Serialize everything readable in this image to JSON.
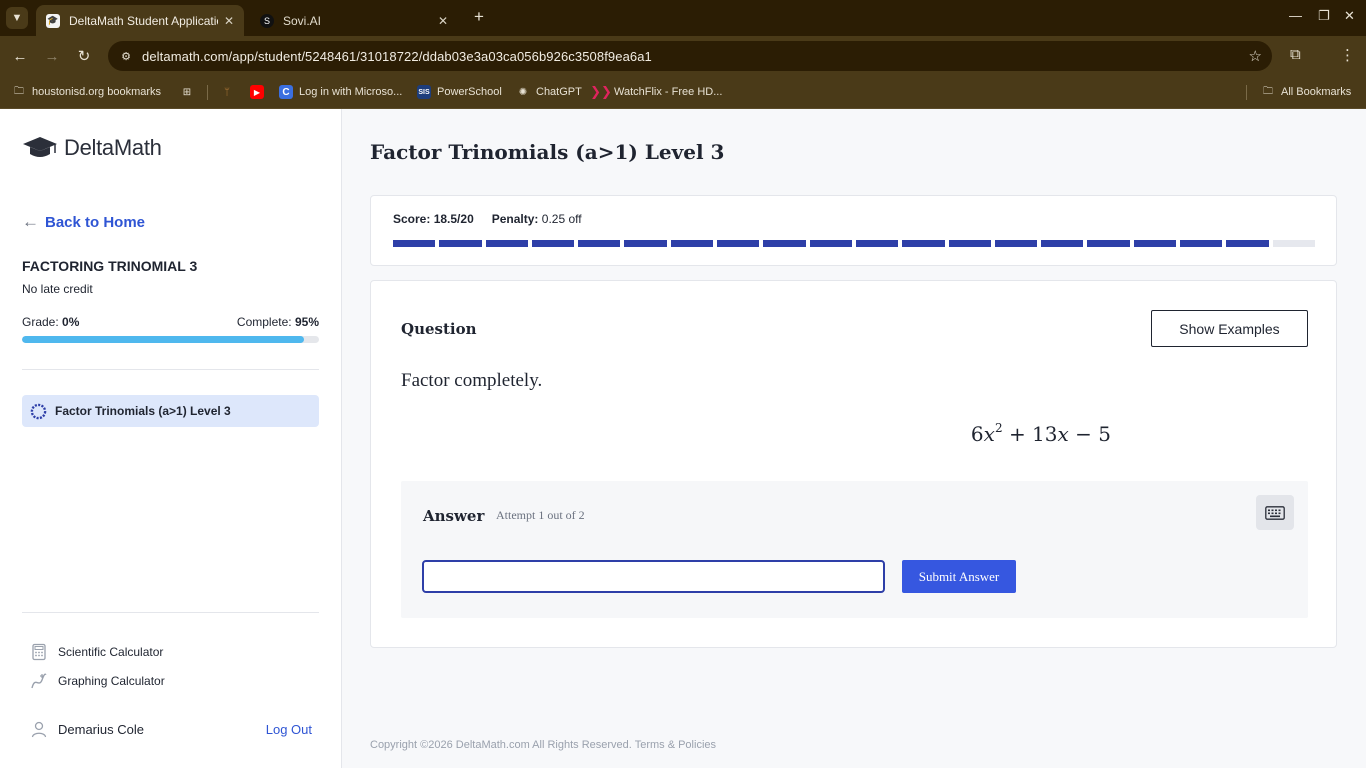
{
  "browser": {
    "tabs": [
      {
        "title": "DeltaMath Student Application",
        "active": true,
        "favicon": "deltamath-cap-icon"
      },
      {
        "title": "Sovi.AI",
        "active": false,
        "favicon": "sovi-icon"
      }
    ],
    "url": "deltamath.com/app/student/5248461/31018722/ddab03e3a03ca056b926c3508f9ea6a1",
    "bookmarks": [
      {
        "label": "houstonisd.org bookmarks",
        "icon": "folder-icon"
      },
      {
        "label": "",
        "icon": "apps-grid-icon"
      },
      {
        "label": "",
        "icon": "figure-icon"
      },
      {
        "label": "",
        "icon": "youtube-icon"
      },
      {
        "label": "Log in with Microso...",
        "icon": "c-icon"
      },
      {
        "label": "PowerSchool",
        "icon": "sis-icon"
      },
      {
        "label": "ChatGPT",
        "icon": "chatgpt-icon"
      },
      {
        "label": "WatchFlix - Free HD...",
        "icon": "watchflix-icon"
      }
    ],
    "all_bookmarks": "All Bookmarks",
    "colors": {
      "frame": "#2b1d04",
      "toolbar": "#4a3a18"
    }
  },
  "sidebar": {
    "logo": {
      "prefix": "Delta",
      "suffix": "Math"
    },
    "back_link": "Back to Home",
    "assignment_title": "FACTORING TRINOMIAL 3",
    "late_credit": "No late credit",
    "grade_label": "Grade:",
    "grade_value": "0%",
    "complete_label": "Complete:",
    "complete_value": "95%",
    "complete_fraction": 0.95,
    "skill": "Factor Trinomials (a>1) Level 3",
    "tools": [
      {
        "label": "Scientific Calculator",
        "icon": "calculator-icon"
      },
      {
        "label": "Graphing Calculator",
        "icon": "graph-icon"
      }
    ],
    "user_name": "Demarius Cole",
    "logout": "Log Out"
  },
  "main": {
    "title": "Factor Trinomials (a>1) Level 3",
    "score_label": "Score:",
    "score_value": "18.5/20",
    "penalty_label": "Penalty:",
    "penalty_value": "0.25 off",
    "progress": {
      "completed": 19,
      "total": 20
    },
    "question": {
      "label": "Question",
      "show_examples": "Show Examples",
      "prompt": "Factor completely.",
      "math": {
        "coef": "6",
        "var": "x",
        "exp": "2",
        "rest_op": "+ 13",
        "rest_var": "x",
        "tail": "− 5"
      }
    },
    "answer": {
      "label": "Answer",
      "attempt": "Attempt 1 out of 2",
      "input_value": "",
      "submit": "Submit Answer"
    },
    "footer": {
      "copyright": "Copyright ©2026 DeltaMath.com All Rights Reserved.",
      "terms": "Terms & Policies"
    },
    "colors": {
      "accent": "#3657e0",
      "progress": "#2e3fa8",
      "complete_bar": "#4fb8ee",
      "active_skill": "#dde7fb"
    }
  }
}
